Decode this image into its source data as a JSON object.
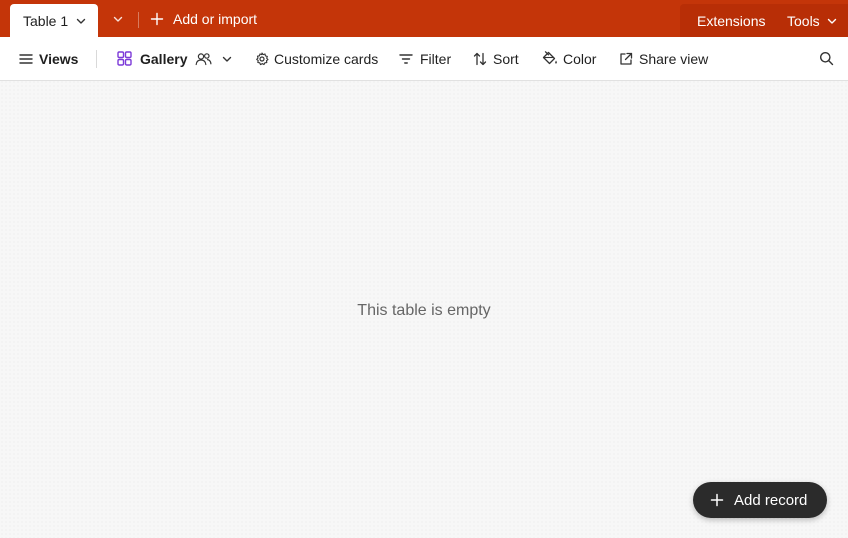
{
  "colors": {
    "tabbar_bg": "#c43509",
    "tabbar_right_bg": "#b82e06",
    "gallery_icon": "#7c3ad8",
    "fab_bg": "#2b2b2b"
  },
  "tabbar": {
    "active_tab": "Table 1",
    "add_import": "Add or import",
    "extensions": "Extensions",
    "tools": "Tools"
  },
  "toolbar": {
    "views": "Views",
    "gallery": "Gallery",
    "customize_cards": "Customize cards",
    "filter": "Filter",
    "sort": "Sort",
    "color": "Color",
    "share_view": "Share view"
  },
  "main": {
    "empty_message": "This table is empty"
  },
  "fab": {
    "label": "Add record"
  }
}
